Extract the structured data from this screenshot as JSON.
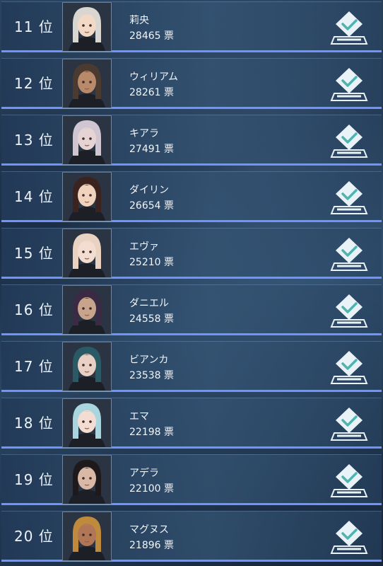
{
  "ranking": {
    "vote_unit": "票",
    "rank_suffix": "位",
    "entries": [
      {
        "rank": "11 位",
        "name": "莉央",
        "votes": "28465 票",
        "hair": "#d9d6d2",
        "skin": "#f1d9c6",
        "icon": "ballot-box-check-icon"
      },
      {
        "rank": "12 位",
        "name": "ウィリアム",
        "votes": "28261 票",
        "hair": "#4a3a30",
        "skin": "#b98a6a",
        "icon": "ballot-box-check-icon"
      },
      {
        "rank": "13 位",
        "name": "キアラ",
        "votes": "27491 票",
        "hair": "#cfc6d2",
        "skin": "#e6d4d4",
        "icon": "ballot-box-check-icon"
      },
      {
        "rank": "14 位",
        "name": "ダイリン",
        "votes": "26654 票",
        "hair": "#3b2420",
        "skin": "#f0d2bd",
        "icon": "ballot-box-check-icon"
      },
      {
        "rank": "15 位",
        "name": "エヴァ",
        "votes": "25210 票",
        "hair": "#ead2c3",
        "skin": "#f3ddd0",
        "icon": "ballot-box-check-icon"
      },
      {
        "rank": "16 位",
        "name": "ダニエル",
        "votes": "24558 票",
        "hair": "#3a2a44",
        "skin": "#c9a48c",
        "icon": "ballot-box-check-icon"
      },
      {
        "rank": "17 位",
        "name": "ビアンカ",
        "votes": "23538 票",
        "hair": "#2a5a66",
        "skin": "#e8d0c4",
        "icon": "ballot-box-check-icon"
      },
      {
        "rank": "18 位",
        "name": "エマ",
        "votes": "22198 票",
        "hair": "#a9d6de",
        "skin": "#f3ddd2",
        "icon": "ballot-box-check-icon"
      },
      {
        "rank": "19 位",
        "name": "アデラ",
        "votes": "22100 票",
        "hair": "#1e1a1c",
        "skin": "#d9b8a6",
        "icon": "ballot-box-check-icon"
      },
      {
        "rank": "20 位",
        "name": "マグヌス",
        "votes": "21896 票",
        "hair": "#c08a3c",
        "skin": "#b07656",
        "icon": "ballot-box-check-icon"
      }
    ]
  },
  "colors": {
    "row_border": "#6f93ff",
    "vote_icon": "#e9f2f7",
    "vote_check": "#4fb3b0"
  }
}
